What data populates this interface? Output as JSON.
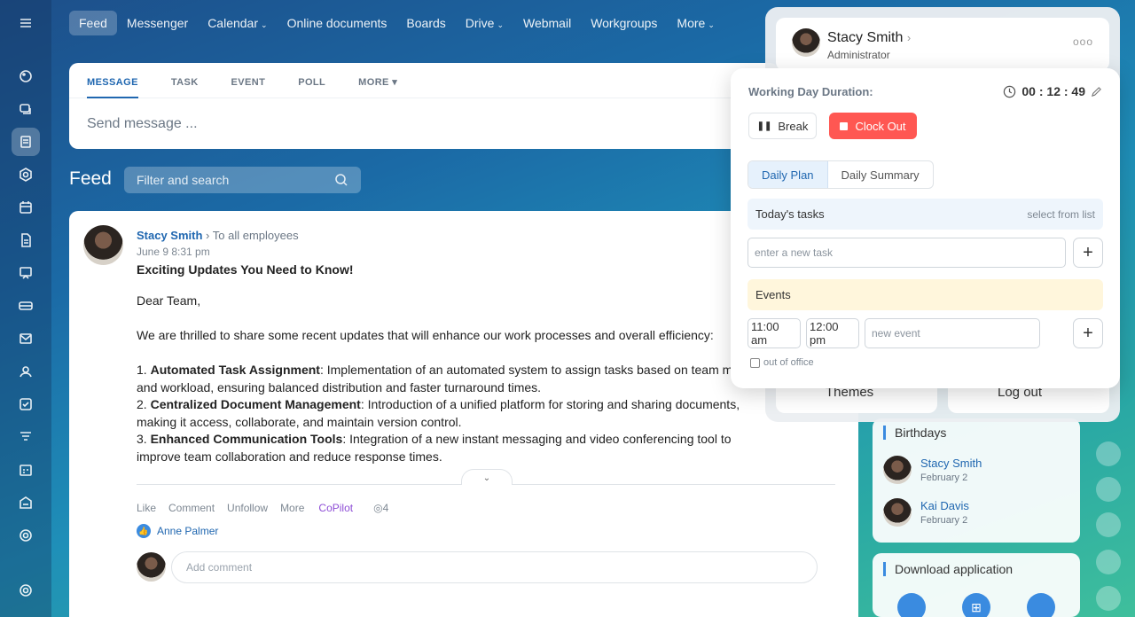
{
  "nav": {
    "items": [
      {
        "label": "Feed",
        "active": true,
        "dropdown": false
      },
      {
        "label": "Messenger",
        "active": false,
        "dropdown": false
      },
      {
        "label": "Calendar",
        "active": false,
        "dropdown": true
      },
      {
        "label": "Online documents",
        "active": false,
        "dropdown": false
      },
      {
        "label": "Boards",
        "active": false,
        "dropdown": false
      },
      {
        "label": "Drive",
        "active": false,
        "dropdown": true
      },
      {
        "label": "Webmail",
        "active": false,
        "dropdown": false
      },
      {
        "label": "Workgroups",
        "active": false,
        "dropdown": false
      },
      {
        "label": "More",
        "active": false,
        "dropdown": true
      }
    ]
  },
  "composer": {
    "tabs": [
      "MESSAGE",
      "TASK",
      "EVENT",
      "POLL",
      "MORE ▾"
    ],
    "placeholder": "Send message ..."
  },
  "feed": {
    "title": "Feed",
    "search_placeholder": "Filter and search"
  },
  "post": {
    "author": "Stacy Smith",
    "recipient": "To all employees",
    "date": "June 9 8:31 pm",
    "title": "Exciting Updates You Need to Know!",
    "greeting": "Dear Team,",
    "intro": "We are thrilled to share some recent updates that will enhance our work processes and overall efficiency:",
    "items": [
      {
        "num": "1.",
        "head": "Automated Task Assignment",
        "text": ": Implementation of an automated system to assign tasks based on team member and workload, ensuring balanced distribution and faster turnaround times."
      },
      {
        "num": "2.",
        "head": "Centralized Document Management",
        "text": ": Introduction of a unified platform for storing and sharing documents, making it access, collaborate, and maintain version control."
      },
      {
        "num": "3.",
        "head": "Enhanced Communication Tools",
        "text": ": Integration of a new instant messaging and video conferencing tool to improve team collaboration and reduce response times."
      }
    ],
    "actions": [
      "Like",
      "Comment",
      "Unfollow",
      "More"
    ],
    "copilot": "CoPilot",
    "views": "4",
    "liked_by": "Anne Palmer",
    "comment_placeholder": "Add comment"
  },
  "profile": {
    "name": "Stacy Smith",
    "role": "Administrator",
    "themes_label": "Themes",
    "logout_label": "Log out"
  },
  "timeman": {
    "label": "Working Day Duration:",
    "timer": "00 : 12 : 49",
    "break_label": "Break",
    "clockout_label": "Clock Out",
    "tabs": [
      "Daily Plan",
      "Daily Summary"
    ],
    "tasks_title": "Today's tasks",
    "tasks_link": "select from list",
    "task_placeholder": "enter a new task",
    "events_title": "Events",
    "event_start": "11:00 am",
    "event_end": "12:00 pm",
    "event_placeholder": "new event",
    "out_of_office": "out of office"
  },
  "birthdays": {
    "title": "Birthdays",
    "people": [
      {
        "name": "Stacy Smith",
        "date": "February 2"
      },
      {
        "name": "Kai Davis",
        "date": "February 2"
      }
    ]
  },
  "download": {
    "title": "Download application"
  },
  "colors": {
    "accent": "#2067b0",
    "clockout": "#ff5752",
    "copilot": "#8e4ed6"
  }
}
